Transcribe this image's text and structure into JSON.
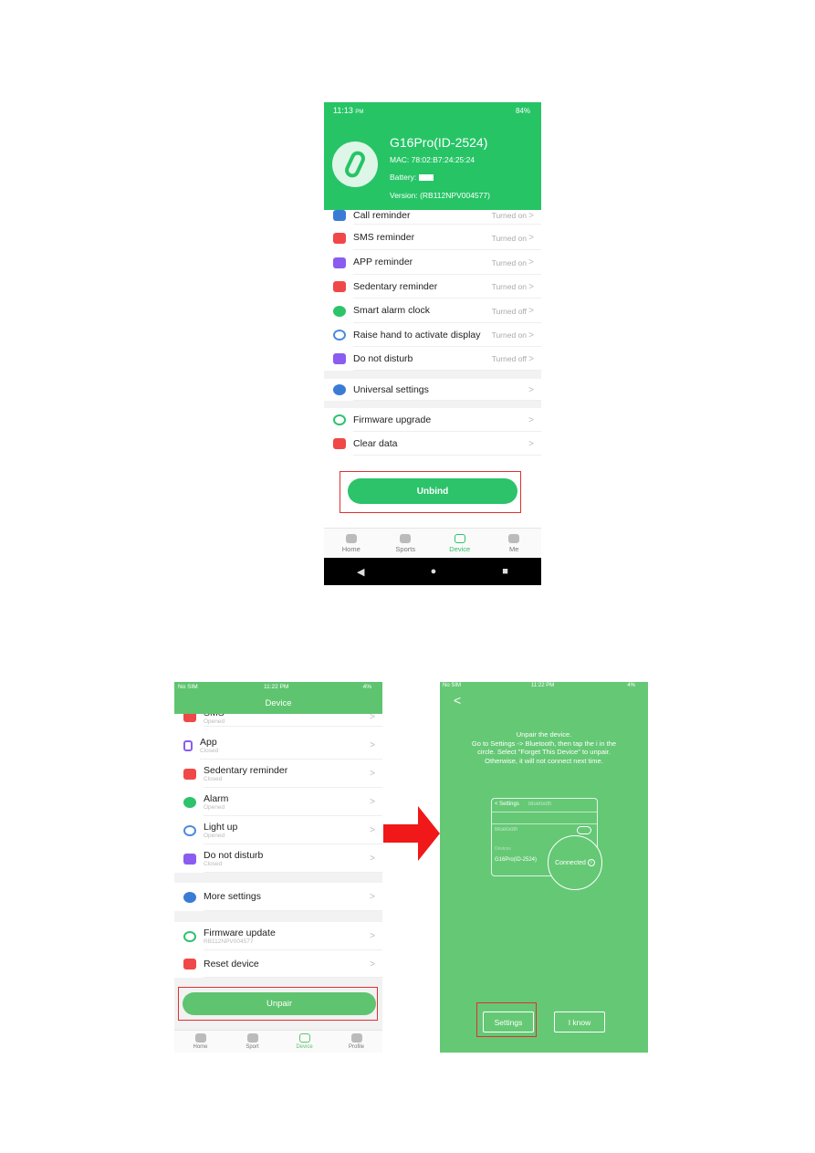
{
  "top": {
    "status": {
      "time": "11:13",
      "ampm": "PM",
      "battery": "84%"
    },
    "device": {
      "name": "G16Pro(ID-2524)",
      "mac": "MAC:  78:02:B7:24:25:24",
      "battery_label": "Battery:",
      "version": "Version:  (RB112NPV004577)"
    },
    "rows": [
      {
        "label": "Call reminder",
        "value": "Turned on",
        "color": "#3a7bd5"
      },
      {
        "label": "SMS reminder",
        "value": "Turned on",
        "color": "#f04848"
      },
      {
        "label": "APP reminder",
        "value": "Turned on",
        "color": "#8a5cf0"
      },
      {
        "label": "Sedentary reminder",
        "value": "Turned on",
        "color": "#f04848"
      },
      {
        "label": "Smart alarm clock",
        "value": "Turned off",
        "color": "#2cc36b"
      },
      {
        "label": "Raise hand to activate display",
        "value": "Turned on",
        "color": "#4a8ae0"
      },
      {
        "label": "Do not disturb",
        "value": "Turned off",
        "color": "#8a5cf0"
      },
      {
        "label": "Universal settings",
        "color": "#3a7bd5"
      },
      {
        "label": "Firmware upgrade",
        "color": "#2cc36b"
      },
      {
        "label": "Clear data",
        "color": "#f04848"
      }
    ],
    "button": "Unbind",
    "tabs": [
      "Home",
      "Sports",
      "Device",
      "Me"
    ]
  },
  "left": {
    "status": {
      "carrier": "No SIM",
      "time": "11:22 PM",
      "battery": "4%"
    },
    "title": "Device",
    "rows": [
      {
        "label": "SMS",
        "sub": "Opened",
        "color": "#f04848"
      },
      {
        "label": "App",
        "sub": "Closed",
        "color": "#8a5cf0"
      },
      {
        "label": "Sedentary reminder",
        "sub": "Closed",
        "color": "#f04848"
      },
      {
        "label": "Alarm",
        "sub": "Opened",
        "color": "#2cc36b"
      },
      {
        "label": "Light up",
        "sub": "Opened",
        "color": "#4a8ae0"
      },
      {
        "label": "Do not disturb",
        "sub": "Closed",
        "color": "#8a5cf0"
      },
      {
        "label": "More settings",
        "color": "#3a7bd5"
      },
      {
        "label": "Firmware update",
        "sub": "RB112NPV004577",
        "color": "#2cc36b"
      },
      {
        "label": "Reset device",
        "color": "#f04848"
      }
    ],
    "button": "Unpair",
    "tabs": [
      "Home",
      "Sport",
      "Device",
      "Profile"
    ]
  },
  "right": {
    "status": {
      "carrier": "No SIM",
      "time": "11:22 PM",
      "battery": "4%"
    },
    "instructions": [
      "Unpair the device.",
      "Go to Settings -> Bluetooth, then tap the i in the",
      "circle. Select \"Forget This Device\" to unpair.",
      "Otherwise, it will not connect next time."
    ],
    "card": {
      "back": "< Settings",
      "title": "Bluetooth",
      "bluetooth": "Bluetooth",
      "section": "Devices",
      "device": "G16Pro(ID-2524)",
      "status": "Connected"
    },
    "settings_button": "Settings",
    "know_button": "I know"
  },
  "colors": {
    "green": "#2cc36b",
    "ios_green": "#65c875",
    "highlight": "#e03030"
  }
}
